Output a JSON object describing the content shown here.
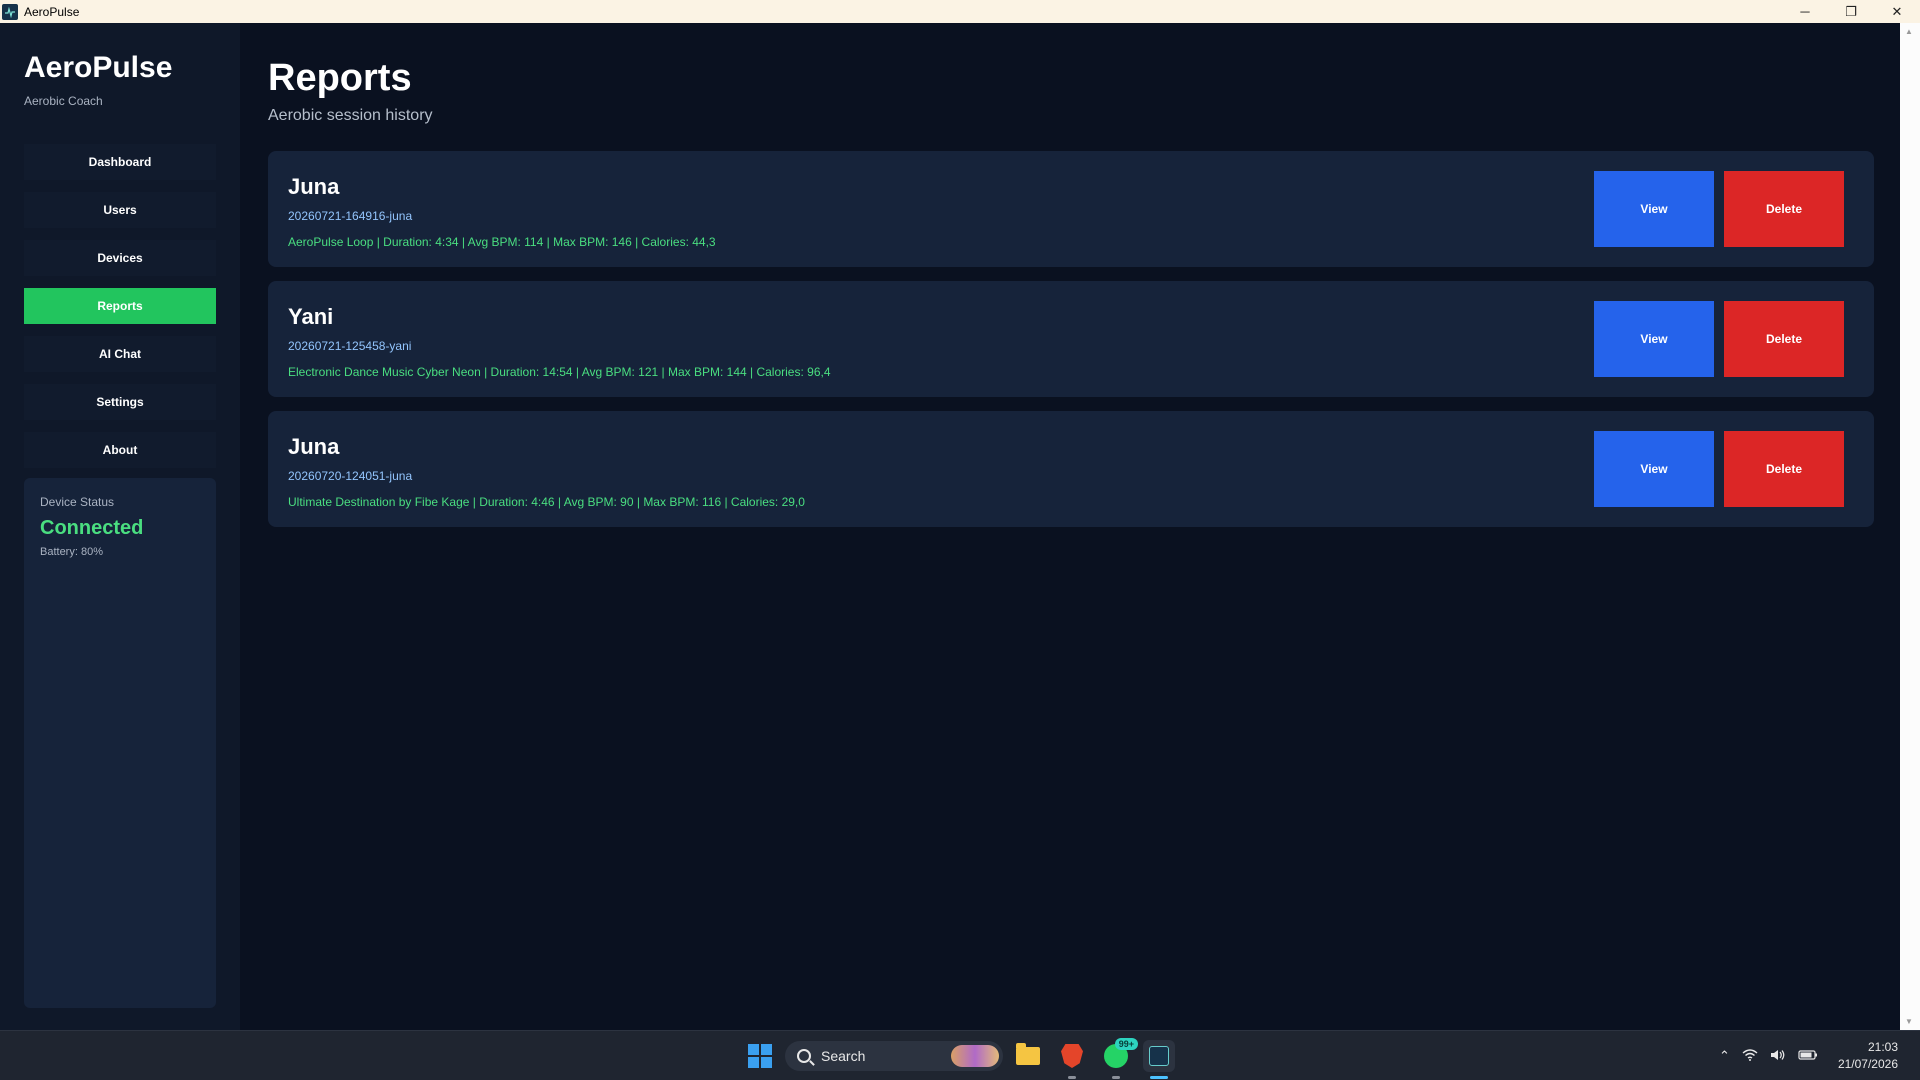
{
  "window": {
    "title": "AeroPulse",
    "controls": {
      "minimize": "─",
      "restore": "❐",
      "close": "✕"
    }
  },
  "sidebar": {
    "brand": "AeroPulse",
    "subtitle": "Aerobic Coach",
    "nav": [
      {
        "label": "Dashboard",
        "active": false
      },
      {
        "label": "Users",
        "active": false
      },
      {
        "label": "Devices",
        "active": false
      },
      {
        "label": "Reports",
        "active": true
      },
      {
        "label": "AI Chat",
        "active": false
      },
      {
        "label": "Settings",
        "active": false
      },
      {
        "label": "About",
        "active": false
      }
    ],
    "device_status": {
      "label": "Device Status",
      "value": "Connected",
      "battery": "Battery: 80%"
    }
  },
  "main": {
    "title": "Reports",
    "subtitle": "Aerobic session history",
    "reports": [
      {
        "name": "Juna",
        "id": "20260721-164916-juna",
        "details": "AeroPulse Loop | Duration: 4:34 | Avg BPM: 114 | Max BPM: 146 | Calories: 44,3",
        "view_label": "View",
        "delete_label": "Delete"
      },
      {
        "name": "Yani",
        "id": "20260721-125458-yani",
        "details": "Electronic Dance Music  Cyber Neon | Duration: 14:54 | Avg BPM: 121 | Max BPM: 144 | Calories: 96,4",
        "view_label": "View",
        "delete_label": "Delete"
      },
      {
        "name": "Juna",
        "id": "20260720-124051-juna",
        "details": "Ultimate Destination by Fibe Kage | Duration: 4:46 | Avg BPM: 90 | Max BPM: 116 | Calories: 29,0",
        "view_label": "View",
        "delete_label": "Delete"
      }
    ]
  },
  "taskbar": {
    "search_label": "Search",
    "whatsapp_badge": "99+",
    "time": "21:03",
    "date": "21/07/2026"
  },
  "colors": {
    "accent": "#22c55e",
    "view_button": "#2563eb",
    "delete_button": "#dc2626",
    "background": "#0a1120",
    "card": "#16233a"
  }
}
